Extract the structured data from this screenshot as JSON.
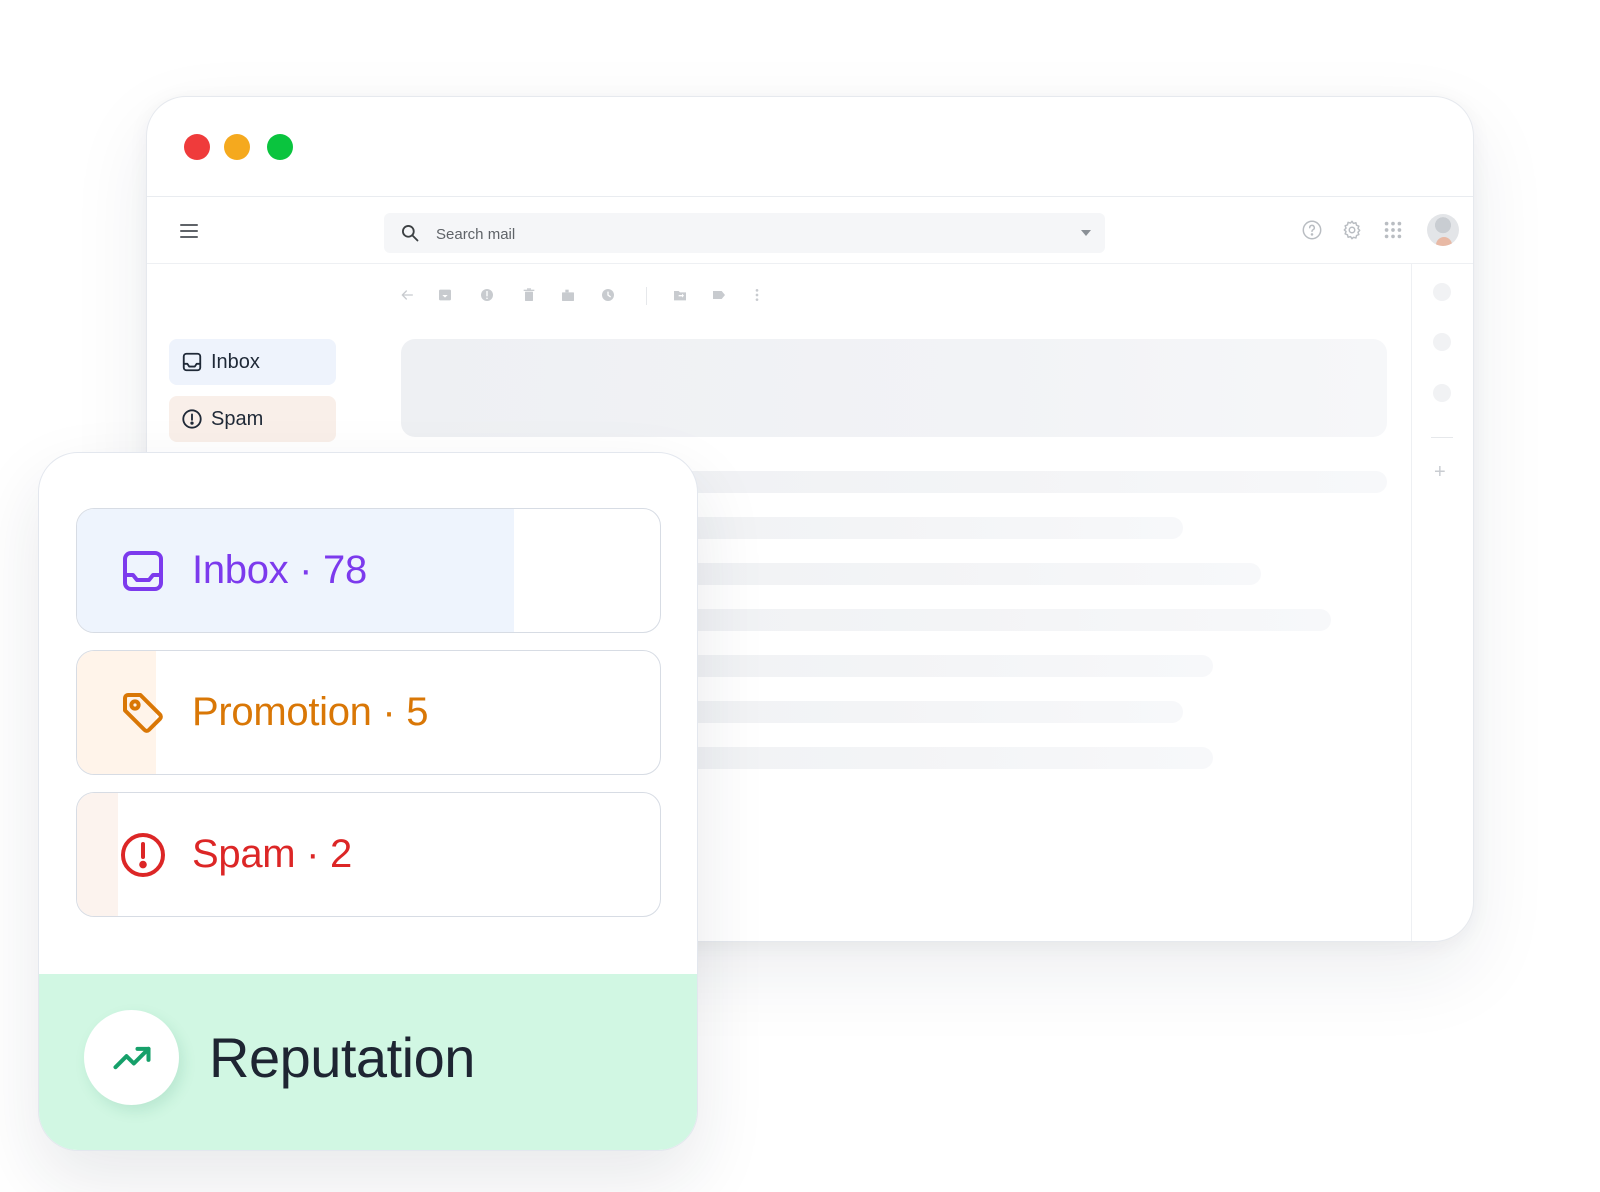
{
  "window": {
    "traffic_lights": [
      {
        "name": "close",
        "color": "#ef3b3b"
      },
      {
        "name": "minimize",
        "color": "#f5a91e"
      },
      {
        "name": "maximize",
        "color": "#0ac43e"
      }
    ]
  },
  "appbar": {
    "menu_icon": "hamburger-icon",
    "search": {
      "placeholder": "Search mail",
      "value": "",
      "icon": "search-icon",
      "dropdown_icon": "caret-down-icon"
    },
    "actions": [
      "help-icon",
      "settings-icon",
      "apps-grid-icon",
      "avatar"
    ]
  },
  "toolbar": {
    "icons": [
      "back-arrow-icon",
      "archive-icon",
      "report-spam-icon",
      "delete-icon",
      "mark-unread-icon",
      "snooze-icon",
      "move-to-icon",
      "label-icon",
      "more-vert-icon"
    ]
  },
  "sidebar": {
    "items": [
      {
        "label": "Inbox",
        "icon": "inbox-icon",
        "background": "#eef3fc"
      },
      {
        "label": "Spam",
        "icon": "alert-circle-icon",
        "background": "#f9efe9"
      }
    ]
  },
  "categories": [
    {
      "label": "Inbox · 78",
      "name": "Inbox",
      "count": 78,
      "icon": "inbox-icon",
      "color": "#7c3aed",
      "fill_color": "#eef4fd",
      "fill_fraction": 0.75
    },
    {
      "label": "Promotion · 5",
      "name": "Promotion",
      "count": 5,
      "icon": "tag-icon",
      "color": "#d97706",
      "fill_color": "#fff4ea",
      "fill_fraction": 0.135
    },
    {
      "label": "Spam · 2",
      "name": "Spam",
      "count": 2,
      "icon": "alert-circle-icon",
      "color": "#dc2626",
      "fill_color": "#fcf3ee",
      "fill_fraction": 0.07
    }
  ],
  "reputation": {
    "label": "Reputation",
    "icon": "trending-up-icon",
    "accent": "#16a06a",
    "background": "#d1f7e3"
  }
}
